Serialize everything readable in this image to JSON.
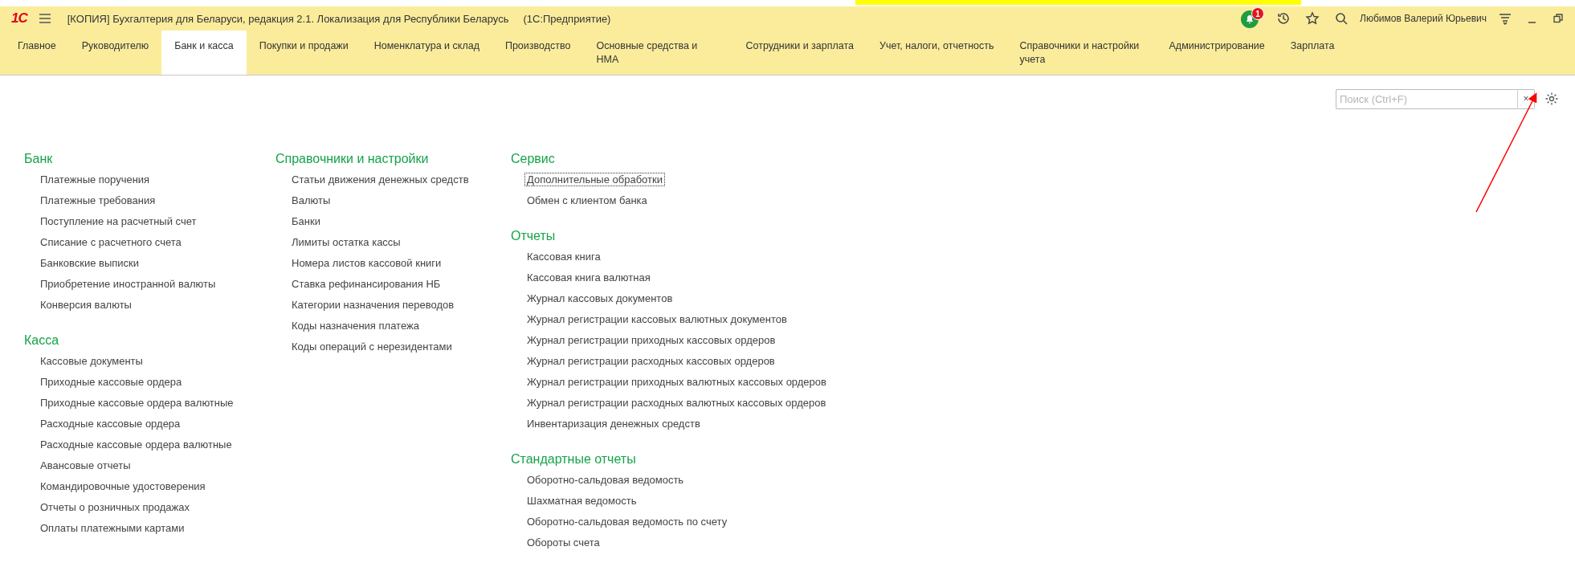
{
  "title_bar": {
    "logo": "1С",
    "title": "[КОПИЯ] Бухгалтерия для Беларуси, редакция 2.1. Локализация для Республики Беларусь",
    "app": "(1С:Предприятие)",
    "notification_count": "1",
    "user": "Любимов Валерий Юрьевич"
  },
  "tabs": [
    {
      "label": "Главное",
      "selected": false
    },
    {
      "label": "Руководителю",
      "selected": false
    },
    {
      "label": "Банк и касса",
      "selected": true
    },
    {
      "label": "Покупки и продажи",
      "selected": false
    },
    {
      "label": "Номенклатура и склад",
      "selected": false
    },
    {
      "label": "Производство",
      "selected": false
    },
    {
      "label": "Основные средства и НМА",
      "selected": false
    },
    {
      "label": "Сотрудники и зарплата",
      "selected": false
    },
    {
      "label": "Учет, налоги, отчетность",
      "selected": false
    },
    {
      "label": "Справочники и настройки учета",
      "selected": false
    },
    {
      "label": "Администрирование",
      "selected": false
    },
    {
      "label": "Зарплата",
      "selected": false
    }
  ],
  "search": {
    "placeholder": "Поиск (Ctrl+F)",
    "clear": "×"
  },
  "columns": [
    {
      "sections": [
        {
          "heading": "Банк",
          "items": [
            {
              "label": "Платежные поручения",
              "focused": false
            },
            {
              "label": "Платежные требования",
              "focused": false
            },
            {
              "label": "Поступление на расчетный счет",
              "focused": false
            },
            {
              "label": "Списание с расчетного счета",
              "focused": false
            },
            {
              "label": "Банковские выписки",
              "focused": false
            },
            {
              "label": "Приобретение иностранной валюты",
              "focused": false
            },
            {
              "label": "Конверсия валюты",
              "focused": false
            }
          ]
        },
        {
          "heading": "Касса",
          "items": [
            {
              "label": "Кассовые документы",
              "focused": false
            },
            {
              "label": "Приходные кассовые ордера",
              "focused": false
            },
            {
              "label": "Приходные кассовые ордера валютные",
              "focused": false
            },
            {
              "label": "Расходные кассовые ордера",
              "focused": false
            },
            {
              "label": "Расходные кассовые ордера валютные",
              "focused": false
            },
            {
              "label": "Авансовые отчеты",
              "focused": false
            },
            {
              "label": "Командировочные удостоверения",
              "focused": false
            },
            {
              "label": "Отчеты о розничных продажах",
              "focused": false
            },
            {
              "label": "Оплаты платежными картами",
              "focused": false
            }
          ]
        }
      ]
    },
    {
      "sections": [
        {
          "heading": "Справочники и настройки",
          "items": [
            {
              "label": "Статьи движения денежных средств",
              "focused": false
            },
            {
              "label": "Валюты",
              "focused": false
            },
            {
              "label": "Банки",
              "focused": false
            },
            {
              "label": "Лимиты остатка кассы",
              "focused": false
            },
            {
              "label": "Номера листов кассовой книги",
              "focused": false
            },
            {
              "label": "Ставка рефинансирования НБ",
              "focused": false
            },
            {
              "label": "Категории назначения переводов",
              "focused": false
            },
            {
              "label": "Коды назначения платежа",
              "focused": false
            },
            {
              "label": "Коды операций с нерезидентами",
              "focused": false
            }
          ]
        }
      ]
    },
    {
      "sections": [
        {
          "heading": "Сервис",
          "items": [
            {
              "label": "Дополнительные обработки",
              "focused": true
            },
            {
              "label": "Обмен с клиентом банка",
              "focused": false
            }
          ]
        },
        {
          "heading": "Отчеты",
          "items": [
            {
              "label": "Кассовая книга",
              "focused": false
            },
            {
              "label": "Кассовая книга валютная",
              "focused": false
            },
            {
              "label": "Журнал кассовых документов",
              "focused": false
            },
            {
              "label": "Журнал регистрации кассовых валютных документов",
              "focused": false
            },
            {
              "label": "Журнал регистрации приходных кассовых ордеров",
              "focused": false
            },
            {
              "label": "Журнал регистрации расходных кассовых ордеров",
              "focused": false
            },
            {
              "label": "Журнал регистрации приходных валютных кассовых ордеров",
              "focused": false
            },
            {
              "label": "Журнал регистрации расходных валютных кассовых ордеров",
              "focused": false
            },
            {
              "label": "Инвентаризация денежных средств",
              "focused": false
            }
          ]
        },
        {
          "heading": "Стандартные отчеты",
          "items": [
            {
              "label": "Оборотно-сальдовая ведомость",
              "focused": false
            },
            {
              "label": "Шахматная ведомость",
              "focused": false
            },
            {
              "label": "Оборотно-сальдовая ведомость по счету",
              "focused": false
            },
            {
              "label": "Обороты счета",
              "focused": false
            }
          ]
        }
      ]
    }
  ]
}
